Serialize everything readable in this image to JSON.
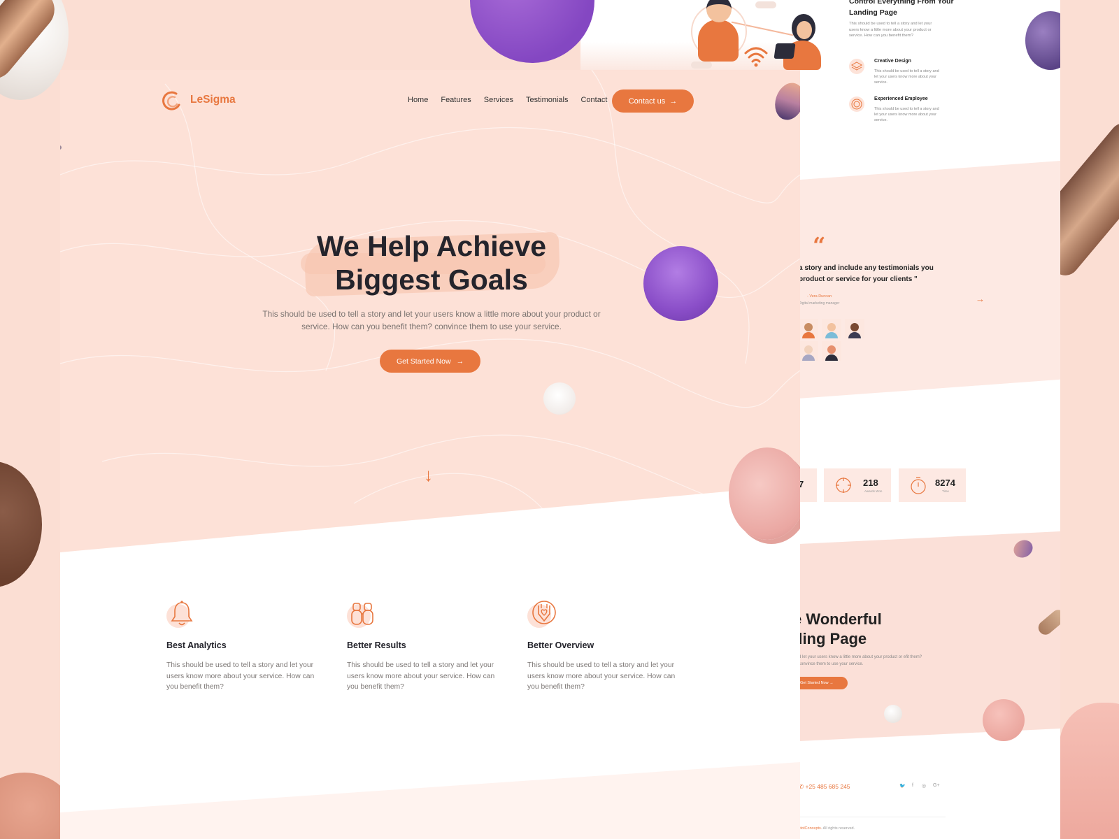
{
  "brand": {
    "name": "LeSigma"
  },
  "nav": {
    "items": [
      "Home",
      "Features",
      "Services",
      "Testimonials",
      "Contact"
    ],
    "cta_label": "Contact us"
  },
  "hero": {
    "title_line1": "We Help Achieve",
    "title_line2": "Biggest Goals",
    "description": "This should be used to tell a story and let your users know a little more about your product or service. How can you benefit them? convince them to use your service.",
    "cta_label": "Get Started Now"
  },
  "features": [
    {
      "title": "Best Analytics",
      "description": "This should be used to tell a story and let your users know more about your service. How can you benefit them?",
      "icon": "bell-icon"
    },
    {
      "title": "Better Results",
      "description": "This should be used to tell a story and let your users know more about your service. How can you benefit them?",
      "icon": "binoculars-icon"
    },
    {
      "title": "Better Overview",
      "description": "This should be used to tell a story and let your users know more about your service. How can you benefit them?",
      "icon": "shield-heart-icon"
    }
  ],
  "preview": {
    "top_title": "Control Everything From Your Landing Page",
    "top_desc": "This should be used to tell a story and let your users know a little more about your product or service. How can you benefit them?",
    "features": [
      {
        "title": "Creative Design",
        "description": "This should be used to tell a story and let your users know more about your service."
      },
      {
        "title": "Experienced Employee",
        "description": "This should be used to tell a story and let your users know more about your service."
      }
    ],
    "quote": "a story and include any testimonials you product or service for your clients \"",
    "quote_author": "- Vera Duncan",
    "quote_role": "Digital marketing manager",
    "stats": [
      {
        "value": "7",
        "label": ""
      },
      {
        "value": "218",
        "label": "Awards Won"
      },
      {
        "value": "8274",
        "label": "Time"
      }
    ],
    "hero2_line1": "e Wonderful",
    "hero2_line2": "ding Page",
    "hero2_desc": "d let your users know a little more about your product or efit them? convince them to use your service.",
    "hero2_cta": "Get Started Now",
    "phone": "+25 485 685 245",
    "footer_brand": "ittolConcepts.",
    "footer_rights": " All rights reserved."
  },
  "colors": {
    "accent": "#e8773f",
    "hero_bg": "#fde1d7",
    "purple": "#8a4ec8"
  }
}
